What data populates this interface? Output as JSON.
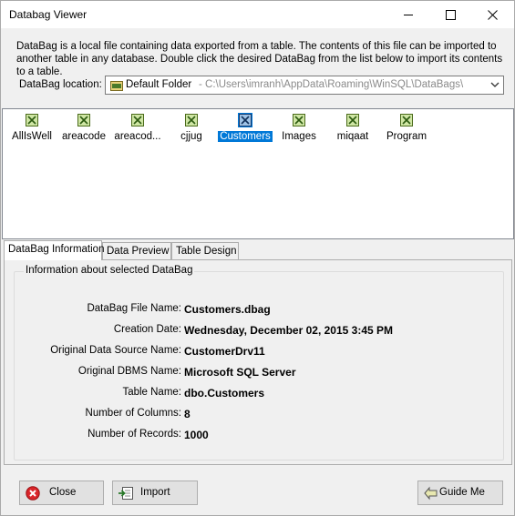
{
  "window": {
    "title": "Databag Viewer"
  },
  "description": "DataBag is a local file containing data exported from a table. The contents of this file can be imported to another table in any database. Double click the desired DataBag from the list below to import its contents to a table.",
  "location": {
    "label": "DataBag location:",
    "folder_name": "Default Folder",
    "path": "- C:\\Users\\imranh\\AppData\\Roaming\\WinSQL\\DataBags\\",
    "icon": "folder-icon"
  },
  "databags": [
    {
      "label": "AllIsWell",
      "icon": "databag-icon",
      "selected": false
    },
    {
      "label": "areacode",
      "icon": "databag-icon",
      "selected": false
    },
    {
      "label": "areacod...",
      "icon": "databag-icon",
      "selected": false
    },
    {
      "label": "cjjug",
      "icon": "databag-icon",
      "selected": false
    },
    {
      "label": "Customers",
      "icon": "databag-icon",
      "selected": true
    },
    {
      "label": "Images",
      "icon": "databag-icon",
      "selected": false
    },
    {
      "label": "miqaat",
      "icon": "databag-icon",
      "selected": false
    },
    {
      "label": "Program",
      "icon": "databag-icon",
      "selected": false
    }
  ],
  "tabs": [
    {
      "label": "DataBag Information",
      "active": true
    },
    {
      "label": "Data Preview",
      "active": false
    },
    {
      "label": "Table Design",
      "active": false
    }
  ],
  "info": {
    "group_label": "Information about selected DataBag",
    "rows": [
      {
        "key": "DataBag File Name:",
        "value": "Customers.dbag"
      },
      {
        "key": "Creation Date:",
        "value": "Wednesday, December 02, 2015 3:45 PM"
      },
      {
        "key": "Original Data Source Name:",
        "value": "CustomerDrv11"
      },
      {
        "key": "Original DBMS Name:",
        "value": "Microsoft SQL Server"
      },
      {
        "key": "Table Name:",
        "value": "dbo.Customers"
      },
      {
        "key": "Number of Columns:",
        "value": "8"
      },
      {
        "key": "Number of Records:",
        "value": "1000"
      }
    ]
  },
  "buttons": {
    "close": {
      "label": "Close",
      "icon": "close-circle-icon"
    },
    "import": {
      "label": "Import",
      "icon": "import-icon"
    },
    "guide": {
      "label": "Guide Me",
      "icon": "guide-icon"
    }
  },
  "colors": {
    "selection": "#0078d7",
    "close_red": "#d9252a"
  }
}
